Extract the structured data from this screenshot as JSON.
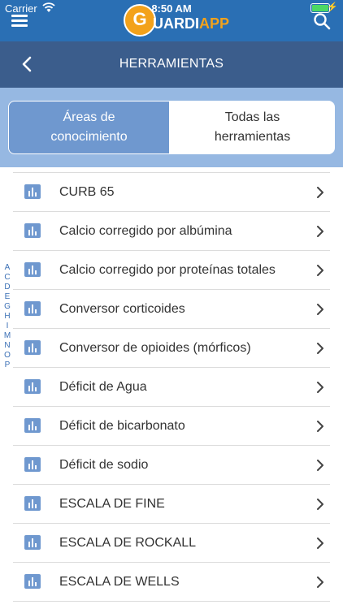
{
  "status_bar": {
    "carrier": "Carrier",
    "time": "8:50 AM"
  },
  "app_bar": {
    "logo_letter": "G",
    "logo_word_white": "UARDI",
    "logo_word_accent": "APP",
    "brand_color": "#2a6fb4",
    "accent_color": "#f3a21b",
    "menu_icon": "hamburger-icon",
    "search_icon": "search-icon"
  },
  "nav": {
    "title": "HERRAMIENTAS",
    "back_icon": "chevron-left-icon",
    "color": "#3b5d8c"
  },
  "segments": {
    "areas_line1": "Áreas de",
    "areas_line2": "conocimiento",
    "todas_line1": "Todas las",
    "todas_line2": "herramientas",
    "selected": "Áreas de conocimiento"
  },
  "items": [
    {
      "label": "CURB 65"
    },
    {
      "label": "Calcio corregido por albúmina"
    },
    {
      "label": "Calcio corregido por proteínas totales"
    },
    {
      "label": "Conversor corticoides"
    },
    {
      "label": "Conversor de opioides (mórficos)"
    },
    {
      "label": "Déficit de Agua"
    },
    {
      "label": "Déficit de bicarbonato"
    },
    {
      "label": "Déficit de sodio"
    },
    {
      "label": "ESCALA DE FINE"
    },
    {
      "label": "ESCALA DE ROCKALL"
    },
    {
      "label": "ESCALA DE WELLS"
    }
  ],
  "alphabet_index": [
    "A",
    "C",
    "D",
    "E",
    "G",
    "H",
    "I",
    "M",
    "N",
    "O",
    "P"
  ]
}
